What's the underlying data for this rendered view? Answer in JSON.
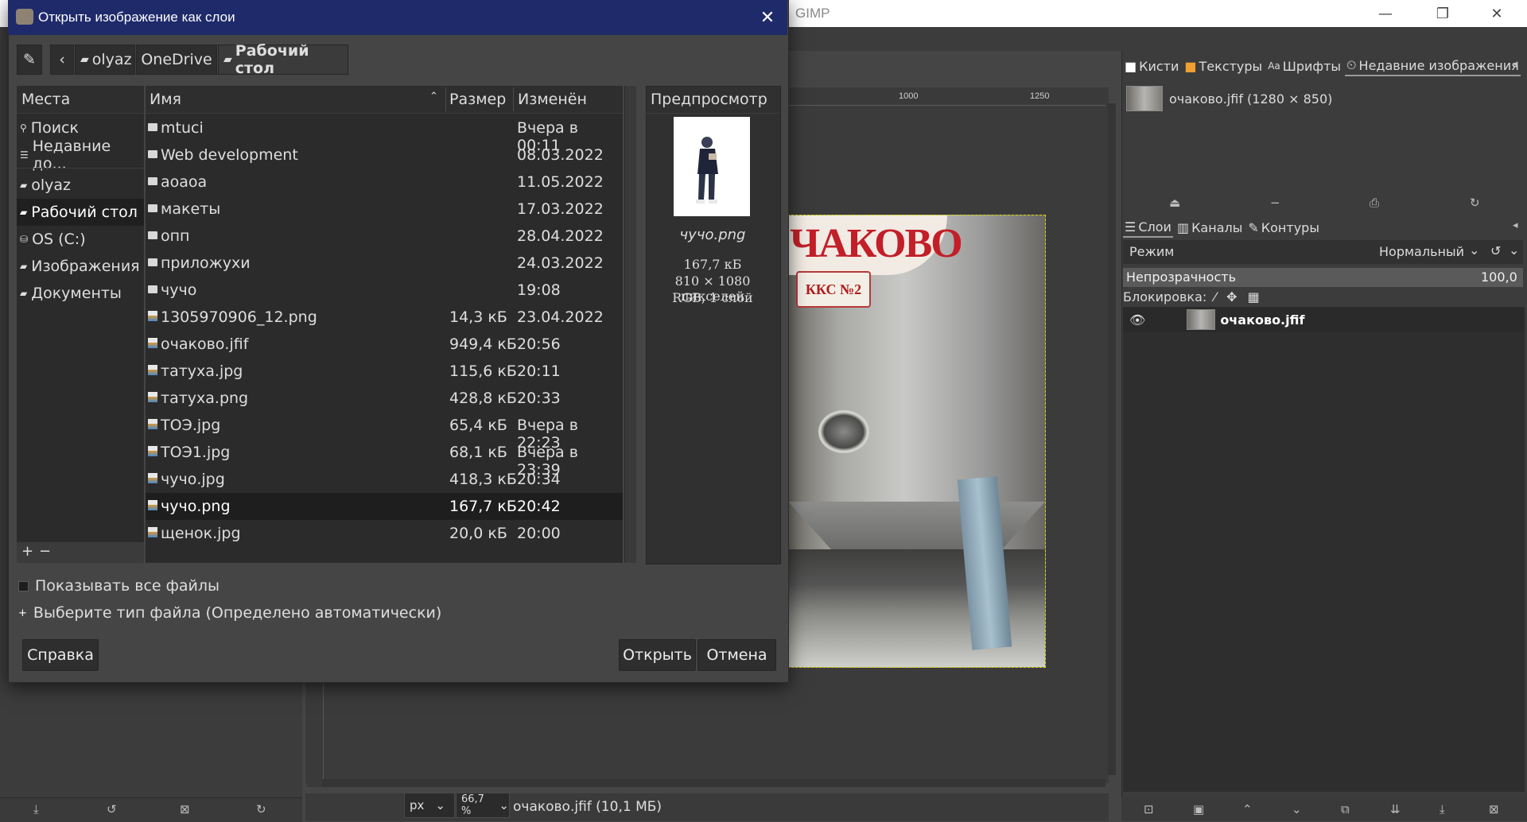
{
  "app": {
    "title": "GIMP",
    "window_controls": {
      "minimize": "—",
      "maximize": "❐",
      "close": "✕"
    }
  },
  "canvas": {
    "ruler_ticks": [
      "1000",
      "1250"
    ],
    "photo_sign_text": "ЧАКОВО",
    "photo_label_text": "ККС №2"
  },
  "statusbar": {
    "unit": "px",
    "zoom": "66,7 %",
    "image_info": "очаково.jfif (10,1 МБ)"
  },
  "docks": {
    "top_tabs": [
      {
        "label": "Кисти",
        "icon": "brush-icon"
      },
      {
        "label": "Текстуры",
        "icon": "pattern-icon"
      },
      {
        "label": "Шрифты",
        "icon": "font-icon"
      },
      {
        "label": "Недавние изображения",
        "icon": "history-icon"
      }
    ],
    "recent_images": [
      {
        "label": "очаково.jfif (1280 × 850)"
      }
    ],
    "layer_tabs": [
      {
        "label": "Слои"
      },
      {
        "label": "Каналы"
      },
      {
        "label": "Контуры"
      }
    ],
    "mode_label": "Режим",
    "mode_value": "Нормальный",
    "opacity_label": "Непрозрачность",
    "opacity_value": "100,0",
    "lock_label": "Блокировка:",
    "layers": [
      {
        "name": "очаково.jfif"
      }
    ]
  },
  "dialog": {
    "title": "Открыть изображение как слои",
    "path": [
      "olyaz",
      "OneDrive",
      "Рабочий стол"
    ],
    "places_header": "Места",
    "places": [
      {
        "label": "Поиск",
        "icon": "search-icon"
      },
      {
        "label": "Недавние до...",
        "icon": "recent-icon"
      },
      {
        "label": "olyaz",
        "icon": "folder-icon"
      },
      {
        "label": "Рабочий стол",
        "icon": "folder-icon",
        "selected": true
      },
      {
        "label": "OS (C:)",
        "icon": "drive-icon"
      },
      {
        "label": "Изображения",
        "icon": "folder-icon"
      },
      {
        "label": "Документы",
        "icon": "folder-icon"
      }
    ],
    "places_footer": {
      "add": "+",
      "remove": "−"
    },
    "columns": {
      "name": "Имя",
      "size": "Размер",
      "modified": "Изменён"
    },
    "files": [
      {
        "name": "mtuci",
        "size": "",
        "date": "Вчера в 00:11",
        "icon": "folder-icon"
      },
      {
        "name": "Web development",
        "size": "",
        "date": "08.03.2022",
        "icon": "folder-icon"
      },
      {
        "name": "аоаоа",
        "size": "",
        "date": "11.05.2022",
        "icon": "folder-icon"
      },
      {
        "name": "макеты",
        "size": "",
        "date": "17.03.2022",
        "icon": "folder-icon"
      },
      {
        "name": "опп",
        "size": "",
        "date": "28.04.2022",
        "icon": "folder-icon"
      },
      {
        "name": "приложухи",
        "size": "",
        "date": "24.03.2022",
        "icon": "folder-icon"
      },
      {
        "name": "чучо",
        "size": "",
        "date": "19:08",
        "icon": "folder-icon"
      },
      {
        "name": "1305970906_12.png",
        "size": "14,3 кБ",
        "date": "23.04.2022",
        "icon": "image-icon"
      },
      {
        "name": "очаково.jfif",
        "size": "949,4 кБ",
        "date": "20:56",
        "icon": "image-icon"
      },
      {
        "name": "татуха.jpg",
        "size": "115,6 кБ",
        "date": "20:11",
        "icon": "image-icon"
      },
      {
        "name": "татуха.png",
        "size": "428,8 кБ",
        "date": "20:33",
        "icon": "image-icon"
      },
      {
        "name": "ТОЭ.jpg",
        "size": "65,4 кБ",
        "date": "Вчера в 22:23",
        "icon": "image-icon"
      },
      {
        "name": "ТОЭ1.jpg",
        "size": "68,1 кБ",
        "date": "Вчера в 23:39",
        "icon": "image-icon"
      },
      {
        "name": "чучо.jpg",
        "size": "418,3 кБ",
        "date": "20:34",
        "icon": "image-icon"
      },
      {
        "name": "чучо.png",
        "size": "167,7 кБ",
        "date": "20:42",
        "icon": "image-icon",
        "selected": true
      },
      {
        "name": "щенок.jpg",
        "size": "20,0 кБ",
        "date": "20:00",
        "icon": "image-icon"
      }
    ],
    "preview_header": "Предпросмотр",
    "preview": {
      "name": "чучо.png",
      "size": "167,7 кБ",
      "dimensions": "810 × 1080 пикселей",
      "mode": "RGB, 1 слой"
    },
    "show_all_files": "Показывать все файлы",
    "select_file_type": "Выберите тип файла (Определено автоматически)",
    "help_button": "Справка",
    "open_button": "Открыть",
    "cancel_button": "Отмена"
  }
}
